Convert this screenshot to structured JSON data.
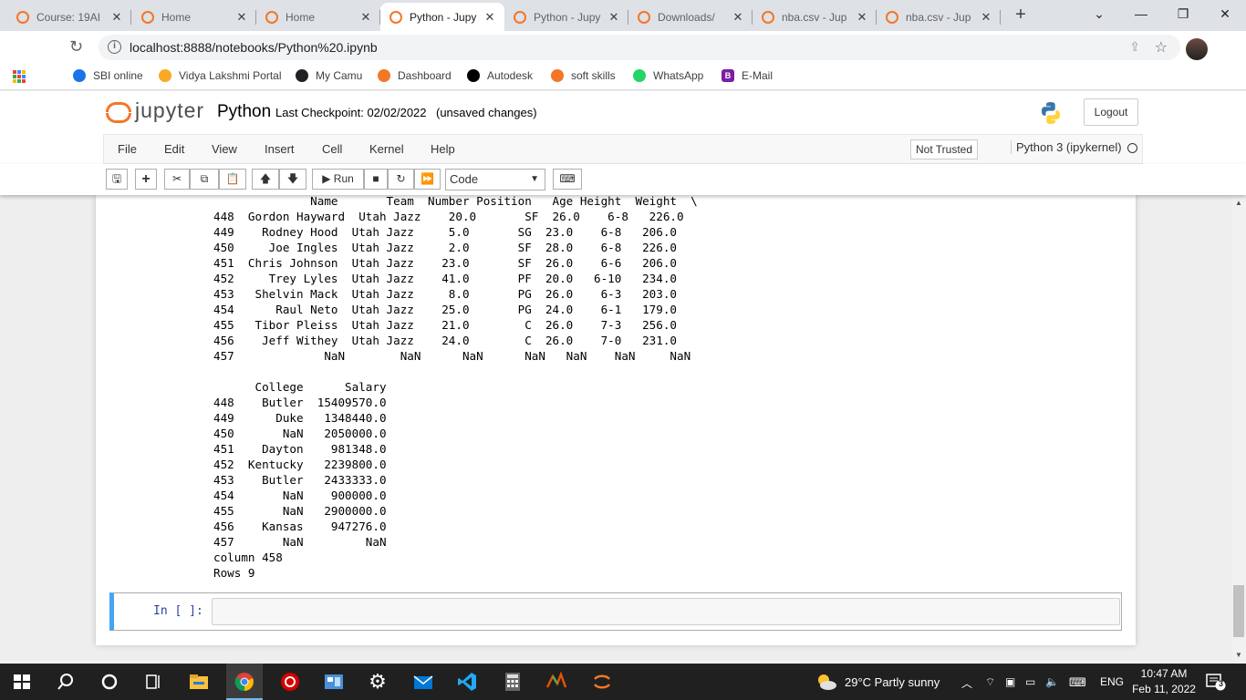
{
  "browser": {
    "tabs": [
      {
        "label": "Course: 19AI",
        "favicon_color": "#f37726",
        "active": false
      },
      {
        "label": "Home",
        "favicon_color": "#f37726",
        "active": false
      },
      {
        "label": "Home",
        "favicon_color": "#f37726",
        "active": false
      },
      {
        "label": "Python - Jupy",
        "favicon_color": "#f37726",
        "active": true
      },
      {
        "label": "Python - Jupy",
        "favicon_color": "#f37726",
        "active": false
      },
      {
        "label": "Downloads/",
        "favicon_color": "#f37726",
        "active": false
      },
      {
        "label": "nba.csv - Jup",
        "favicon_color": "#f37726",
        "active": false
      },
      {
        "label": "nba.csv - Jup",
        "favicon_color": "#f37726",
        "active": false
      }
    ],
    "new_tab_glyph": "+",
    "window_controls": {
      "dropdown": "⌄",
      "minimize": "—",
      "restore": "❐",
      "close": "✕"
    },
    "url": "localhost:8888/notebooks/Python%20.ipynb",
    "bookmarks": [
      {
        "label": "SBI online",
        "icon_color": "#1a73e8"
      },
      {
        "label": "Vidya Lakshmi Portal",
        "icon_color": "#f9a825"
      },
      {
        "label": "My Camu",
        "icon_color": "#202124"
      },
      {
        "label": "Dashboard",
        "icon_color": "#f37726"
      },
      {
        "label": "Autodesk",
        "icon_color": "#000000"
      },
      {
        "label": "soft skills",
        "icon_color": "#f37726"
      },
      {
        "label": "WhatsApp",
        "icon_color": "#25d366"
      },
      {
        "label": "E-Mail",
        "icon_color": "#7b1fa2",
        "icon_text": "B"
      }
    ]
  },
  "jupyter": {
    "logo_text": "jupyter",
    "notebook_name": "Python",
    "checkpoint": "Last Checkpoint: 02/02/2022",
    "unsaved": "(unsaved changes)",
    "logout_label": "Logout",
    "menus": [
      "File",
      "Edit",
      "View",
      "Insert",
      "Cell",
      "Kernel",
      "Help"
    ],
    "trust_status": "Not Trusted",
    "kernel_name": "Python 3 (ipykernel)",
    "toolbar": {
      "run_label": "Run",
      "cell_type": "Code"
    },
    "output_lines": [
      "              Name       Team  Number Position   Age Height  Weight  \\",
      "448  Gordon Hayward  Utah Jazz    20.0       SF  26.0    6-8   226.0   ",
      "449    Rodney Hood  Utah Jazz     5.0       SG  23.0    6-8   206.0   ",
      "450     Joe Ingles  Utah Jazz     2.0       SF  28.0    6-8   226.0   ",
      "451  Chris Johnson  Utah Jazz    23.0       SF  26.0    6-6   206.0   ",
      "452     Trey Lyles  Utah Jazz    41.0       PF  20.0   6-10   234.0   ",
      "453   Shelvin Mack  Utah Jazz     8.0       PG  26.0    6-3   203.0   ",
      "454      Raul Neto  Utah Jazz    25.0       PG  24.0    6-1   179.0   ",
      "455   Tibor Pleiss  Utah Jazz    21.0        C  26.0    7-3   256.0   ",
      "456    Jeff Withey  Utah Jazz    24.0        C  26.0    7-0   231.0   ",
      "457             NaN        NaN      NaN      NaN   NaN    NaN     NaN   ",
      "",
      "      College      Salary",
      "448    Butler  15409570.0",
      "449      Duke   1348440.0",
      "450       NaN   2050000.0",
      "451    Dayton    981348.0",
      "452  Kentucky   2239800.0",
      "453    Butler   2433333.0",
      "454       NaN    900000.0",
      "455       NaN   2900000.0",
      "456    Kansas    947276.0",
      "457       NaN         NaN",
      "column 458",
      "Rows 9"
    ],
    "input_prompt": "In [ ]:"
  },
  "taskbar": {
    "weather": "29°C  Partly sunny",
    "language": "ENG",
    "time": "10:47 AM",
    "date": "Feb 11, 2022",
    "notification_count": "3"
  }
}
